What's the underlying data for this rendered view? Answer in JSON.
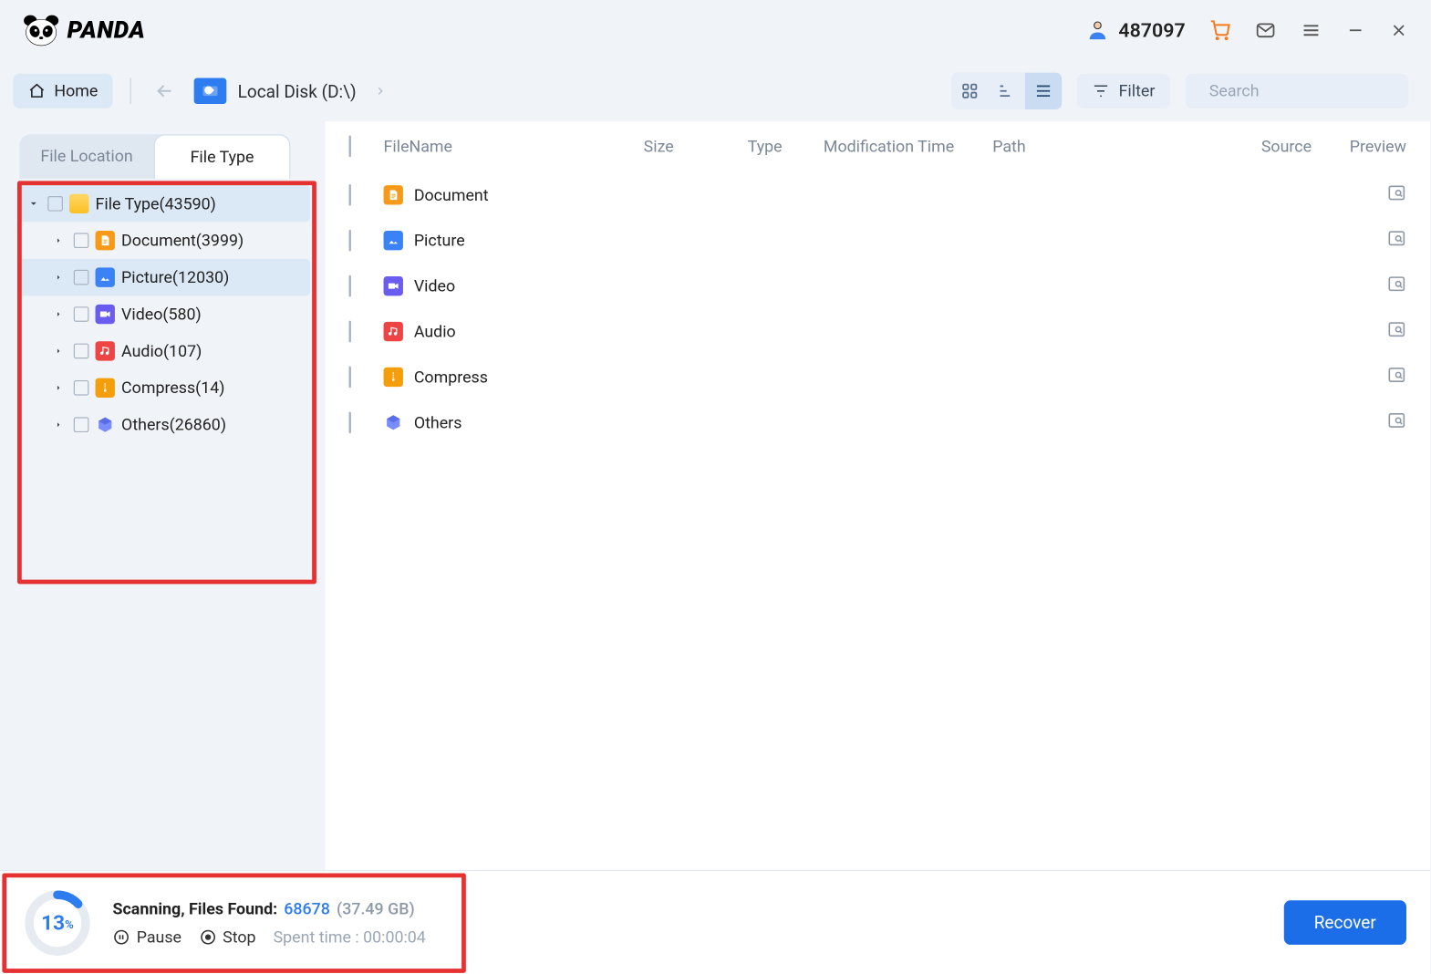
{
  "brand": "PANDA",
  "header": {
    "user_id": "487097"
  },
  "toolbar": {
    "home_label": "Home",
    "disk_label": "Local Disk (D:\\)",
    "filter_label": "Filter",
    "search_placeholder": "Search"
  },
  "sidebar": {
    "tabs": {
      "location": "File Location",
      "type": "File Type"
    },
    "root": {
      "label": "File Type",
      "count": "(43590)"
    },
    "items": [
      {
        "label": "Document",
        "count": "(3999)",
        "icon": "ic-doc"
      },
      {
        "label": "Picture",
        "count": "(12030)",
        "icon": "ic-pic",
        "selected": true
      },
      {
        "label": "Video",
        "count": "(580)",
        "icon": "ic-vid"
      },
      {
        "label": "Audio",
        "count": "(107)",
        "icon": "ic-aud"
      },
      {
        "label": "Compress",
        "count": "(14)",
        "icon": "ic-zip"
      },
      {
        "label": "Others",
        "count": "(26860)",
        "icon": "ic-oth"
      }
    ]
  },
  "columns": {
    "name": "FileName",
    "size": "Size",
    "type": "Type",
    "mod": "Modification Time",
    "path": "Path",
    "source": "Source",
    "preview": "Preview"
  },
  "rows": [
    {
      "label": "Document",
      "icon": "ic-doc"
    },
    {
      "label": "Picture",
      "icon": "ic-pic"
    },
    {
      "label": "Video",
      "icon": "ic-vid"
    },
    {
      "label": "Audio",
      "icon": "ic-aud"
    },
    {
      "label": "Compress",
      "icon": "ic-zip"
    },
    {
      "label": "Others",
      "icon": "ic-oth"
    }
  ],
  "footer": {
    "percent": "13",
    "scanning_label": "Scanning, Files Found:",
    "files_found": "68678",
    "total_size": "(37.49 GB)",
    "pause_label": "Pause",
    "stop_label": "Stop",
    "spent_label": "Spent time : 00:00:04",
    "recover_label": "Recover"
  },
  "colors": {
    "accent": "#2d7cf0",
    "highlight_red": "#e53131"
  }
}
